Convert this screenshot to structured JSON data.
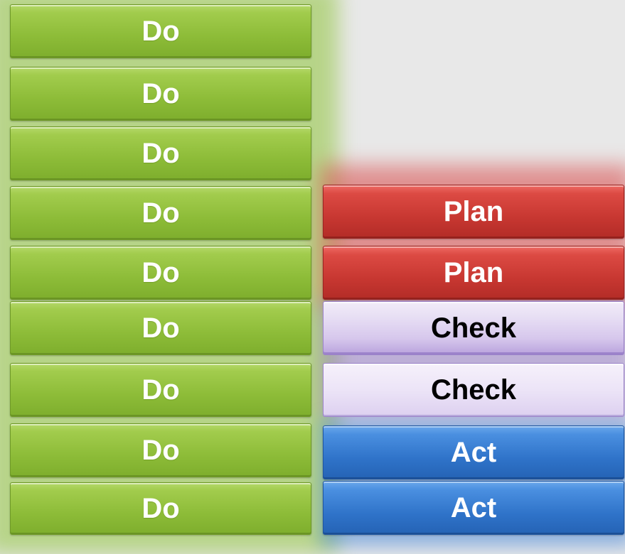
{
  "colors": {
    "background": "#e8e8e8",
    "do": "#8dbc38",
    "plan": "#c73731",
    "check": "#e7def4",
    "act": "#2f73c9"
  },
  "left_column": {
    "blocks": [
      "Do",
      "Do",
      "Do",
      "Do",
      "Do",
      "Do",
      "Do",
      "Do",
      "Do"
    ]
  },
  "right_column": {
    "blocks": [
      "Plan",
      "Plan",
      "Check",
      "Check",
      "Act",
      "Act"
    ]
  }
}
